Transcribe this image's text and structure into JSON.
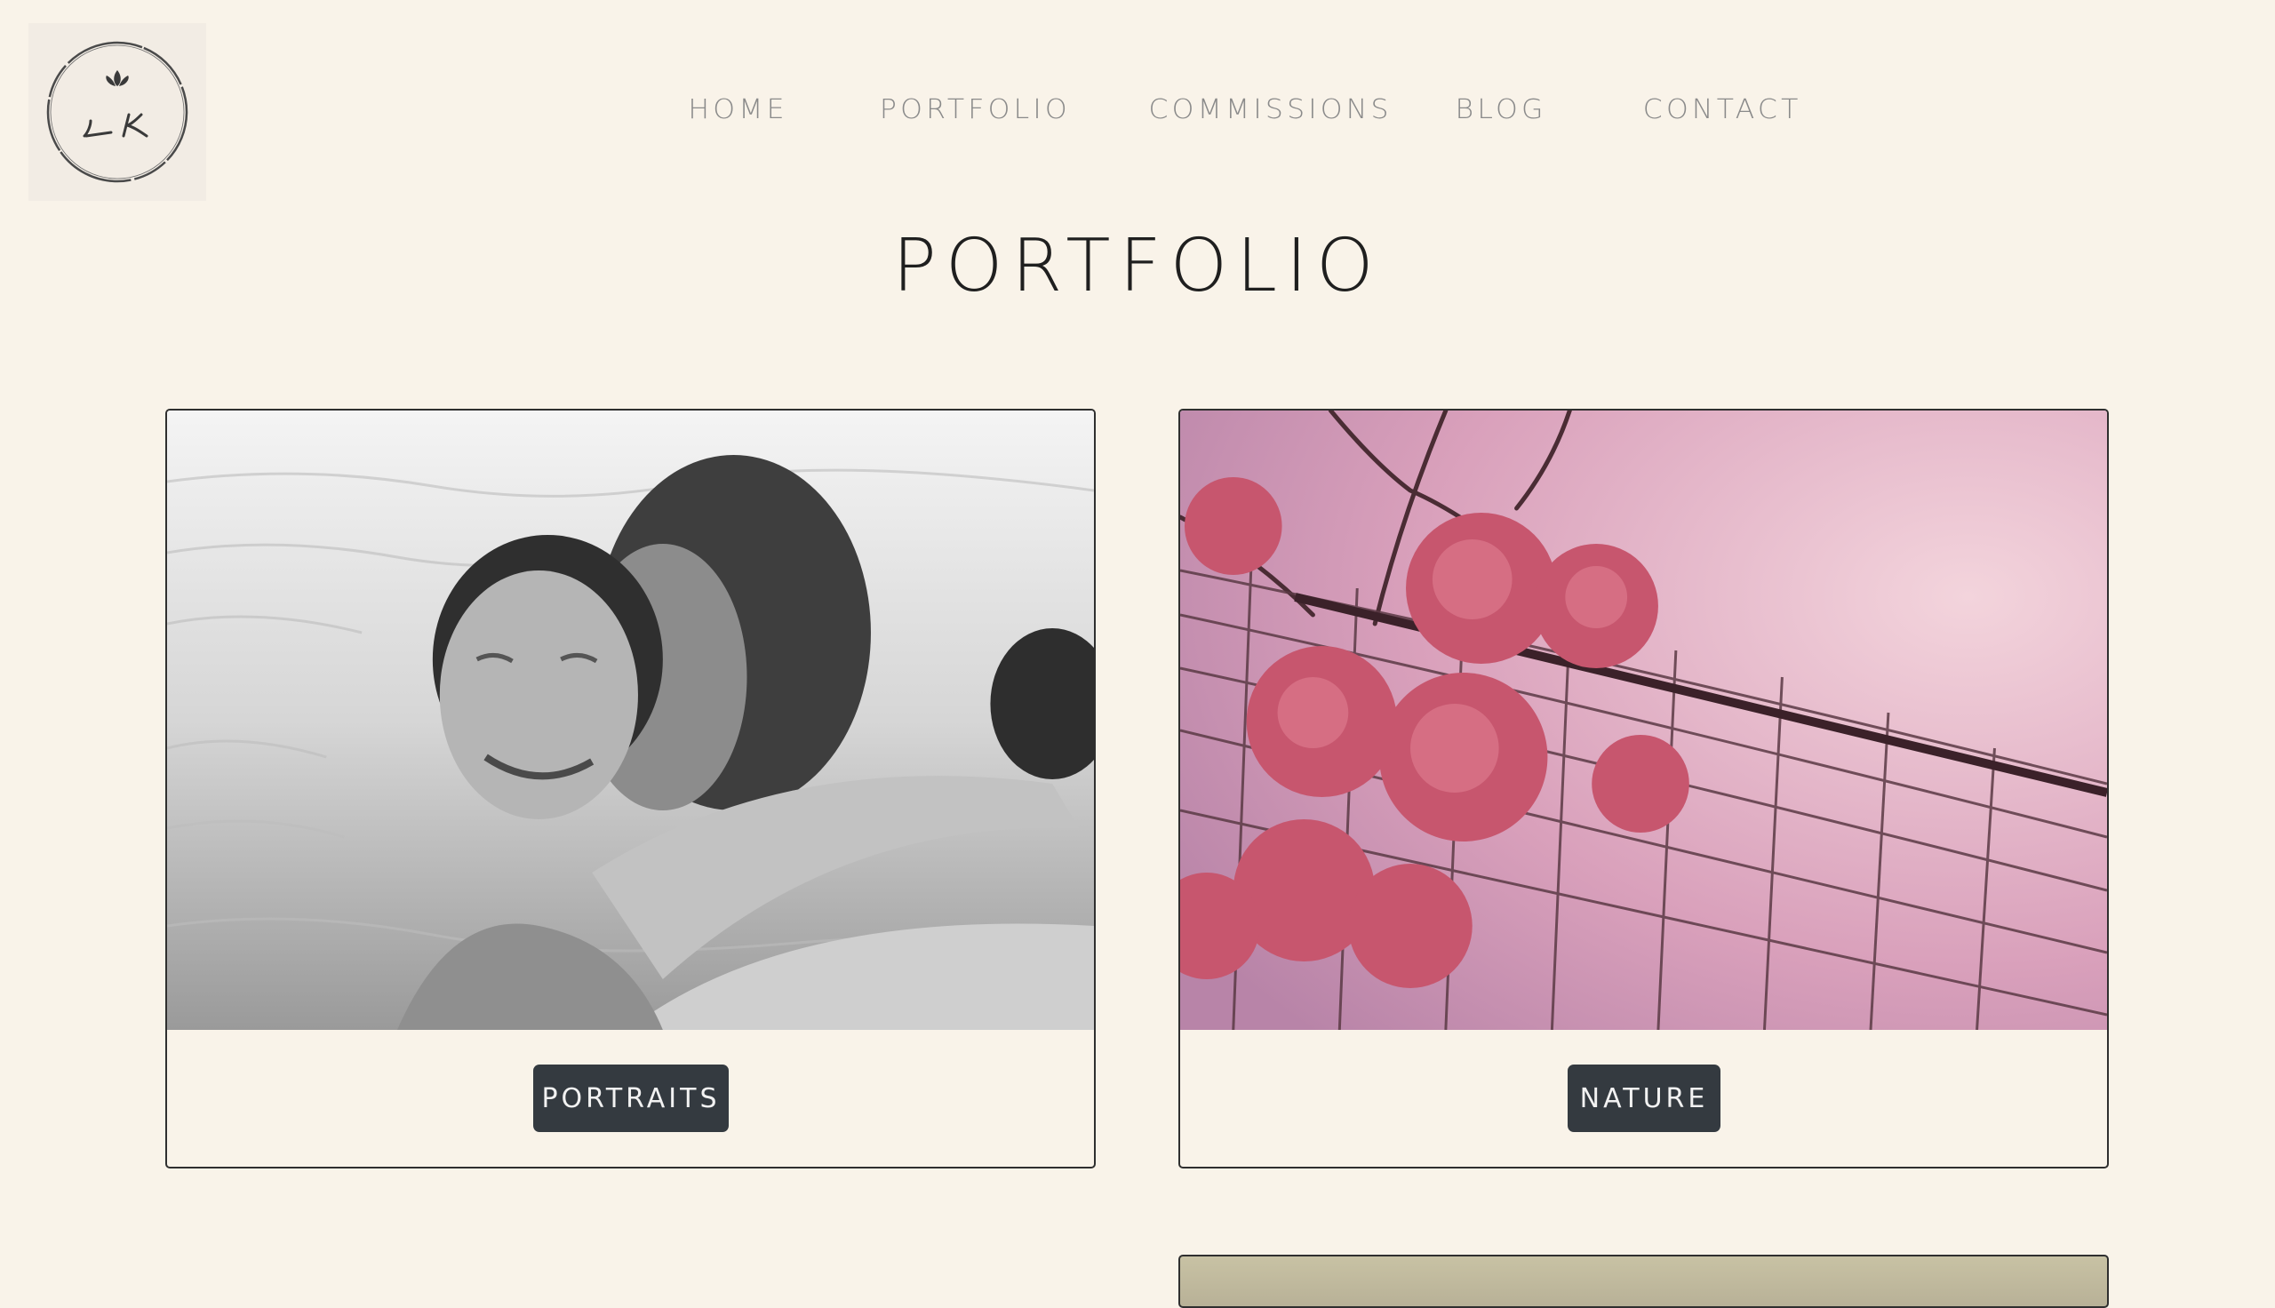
{
  "logo": {
    "initials": "LK",
    "icon": "lotus-icon"
  },
  "nav": {
    "items": [
      {
        "label": "HOME"
      },
      {
        "label": "PORTFOLIO"
      },
      {
        "label": "COMMISSIONS"
      },
      {
        "label": "BLOG"
      },
      {
        "label": "CONTACT"
      }
    ]
  },
  "page": {
    "title": "PORTFOLIO"
  },
  "cards": [
    {
      "category": "PORTRAITS",
      "image": "black-and-white photo of two women embracing in water"
    },
    {
      "category": "NATURE",
      "image": "pink blossoms against a hammock net"
    }
  ],
  "colors": {
    "background": "#f9f3e9",
    "button": "#343a40",
    "nav_text": "#8a8a8a",
    "title_text": "#1f1f1f"
  }
}
